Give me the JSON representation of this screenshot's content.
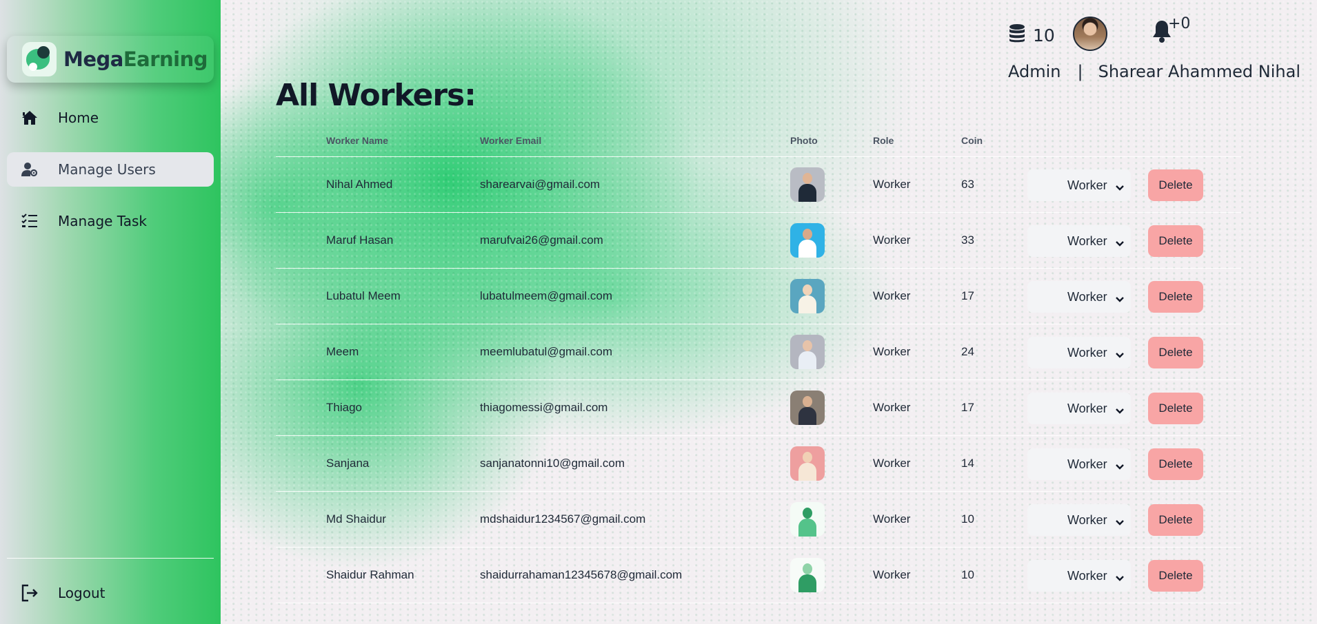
{
  "brand": {
    "mega": "Mega",
    "earning": "Earning"
  },
  "sidebar": {
    "items": [
      {
        "label": "Home",
        "icon": "home-icon"
      },
      {
        "label": "Manage Users",
        "icon": "user-gear-icon",
        "active": true
      },
      {
        "label": "Manage Task",
        "icon": "list-check-icon"
      }
    ],
    "logout": "Logout"
  },
  "header": {
    "coins": "10",
    "notifications": "+0",
    "role": "Admin",
    "separator": "|",
    "user_name": "Sharear Ahammed Nihal"
  },
  "page": {
    "title": "All Workers:"
  },
  "table": {
    "columns": [
      "Worker Name",
      "Worker Email",
      "Photo",
      "Role",
      "Coin"
    ],
    "rows": [
      {
        "name": "Nihal Ahmed",
        "email": "sharearvai@gmail.com",
        "role": "Worker",
        "coin": "63",
        "select": "Worker",
        "action": "Delete",
        "photo": "#b9bcc4",
        "skin": "#e0b595",
        "cloth": "#1f2a38"
      },
      {
        "name": "Maruf Hasan",
        "email": "marufvai26@gmail.com",
        "role": "Worker",
        "coin": "33",
        "select": "Worker",
        "action": "Delete",
        "photo": "#2fb2e6",
        "skin": "#d8a98a",
        "cloth": "#ffffff"
      },
      {
        "name": "Lubatul Meem",
        "email": "lubatulmeem@gmail.com",
        "role": "Worker",
        "coin": "17",
        "select": "Worker",
        "action": "Delete",
        "photo": "#5aa6c0",
        "skin": "#f0d3b8",
        "cloth": "#f7f2e6"
      },
      {
        "name": "Meem",
        "email": "meemlubatul@gmail.com",
        "role": "Worker",
        "coin": "24",
        "select": "Worker",
        "action": "Delete",
        "photo": "#b4b6c0",
        "skin": "#e7c3a9",
        "cloth": "#e9eef5"
      },
      {
        "name": "Thiago",
        "email": "thiagomessi@gmail.com",
        "role": "Worker",
        "coin": "17",
        "select": "Worker",
        "action": "Delete",
        "photo": "#8a7f74",
        "skin": "#d9b091",
        "cloth": "#2e3340"
      },
      {
        "name": "Sanjana",
        "email": "sanjanatonni10@gmail.com",
        "role": "Worker",
        "coin": "14",
        "select": "Worker",
        "action": "Delete",
        "photo": "#ee9f9f",
        "skin": "#f1d0b5",
        "cloth": "#f6e7d6"
      },
      {
        "name": "Md Shaidur",
        "email": "mdshaidur1234567@gmail.com",
        "role": "Worker",
        "coin": "10",
        "select": "Worker",
        "action": "Delete",
        "photo": "#f4fbf6",
        "skin": "#2f9d64",
        "cloth": "#54c38a"
      },
      {
        "name": "Shaidur Rahman",
        "email": "shaidurrahaman12345678@gmail.com",
        "role": "Worker",
        "coin": "10",
        "select": "Worker",
        "action": "Delete",
        "photo": "#f7fbf8",
        "skin": "#8fd3a8",
        "cloth": "#2f9d64"
      }
    ]
  },
  "colors": {
    "accent": "#2ec45f",
    "delete": "#f8a5a5",
    "select_bg": "#f3f4f6"
  }
}
